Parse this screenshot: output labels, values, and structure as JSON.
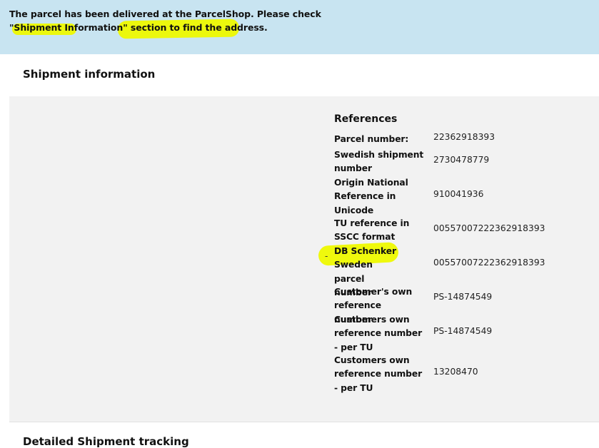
{
  "banner": {
    "line1": "The parcel has been delivered at the ParcelShop. Please check",
    "line2": "\"Shipment Information\" section to find the address."
  },
  "shipment_info": {
    "title": "Shipment information",
    "references_title": "References",
    "references": [
      {
        "label": "Parcel number:",
        "value": "22362918393"
      },
      {
        "label": "Swedish shipment number",
        "value": "2730478779"
      },
      {
        "label": "Origin National Reference in Unicode",
        "value": "910041936"
      },
      {
        "label": "TU reference in SSCC format",
        "value": "00557007222362918393"
      },
      {
        "label": "DB Schenker Sweden parcel number",
        "value": "00557007222362918393"
      },
      {
        "label": "Customer's own reference number",
        "value": "PS-14874549"
      },
      {
        "label": "Customers own reference number - per TU",
        "value": "PS-14874549"
      },
      {
        "label": "Customers own reference number - per TU",
        "value": "13208470"
      }
    ],
    "dash": "-"
  },
  "tracking": {
    "title": "Detailed Shipment tracking"
  },
  "colors": {
    "banner_bg": "#c8e4f1",
    "highlight": "#eef900",
    "panel_bg": "#f2f2f2"
  }
}
